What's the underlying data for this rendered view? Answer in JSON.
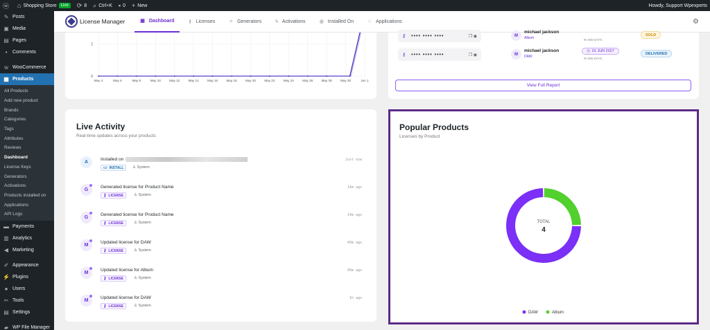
{
  "adminbar": {
    "site_name": "Shopping Store",
    "live_badge": "Live",
    "updates_count": "8",
    "shortcut": "Ctrl+K",
    "comments_count": "0",
    "new_label": "New",
    "howdy": "Howdy, Support Wpexperts"
  },
  "sidebar": {
    "items_top": [
      "Posts",
      "Media",
      "Pages",
      "Comments"
    ],
    "woocommerce": "WooCommerce",
    "products": "Products",
    "submenu": [
      "All Products",
      "Add new product",
      "Brands",
      "Categories",
      "Tags",
      "Attributes",
      "Reviews",
      "Dashboard",
      "License Keys",
      "Generators",
      "Activations",
      "Products installed on",
      "Applications",
      "API Logs"
    ],
    "items_mid": [
      "Payments",
      "Analytics",
      "Marketing"
    ],
    "items_bottom": [
      "Appearance",
      "Plugins",
      "Users",
      "Tools",
      "Settings"
    ],
    "file_manager": "WP File Manager"
  },
  "topnav": {
    "logo": "License Manager",
    "tabs": [
      "Dashboard",
      "Licenses",
      "Generators",
      "Activations",
      "Installed On",
      "Applications"
    ]
  },
  "chart": {
    "y_ticks": [
      "2",
      "0"
    ],
    "x_ticks": [
      "May 4",
      "May 6",
      "May 8",
      "May 10",
      "May 12",
      "May 14",
      "May 16",
      "May 18",
      "May 20",
      "May 22",
      "May 24",
      "May 26",
      "May 28",
      "May 30",
      "Jun 1"
    ]
  },
  "chart_data": {
    "type": "line",
    "x": [
      "May 4",
      "May 6",
      "May 8",
      "May 10",
      "May 12",
      "May 14",
      "May 16",
      "May 18",
      "May 20",
      "May 22",
      "May 24",
      "May 26",
      "May 28",
      "May 30",
      "Jun 1"
    ],
    "series": [
      {
        "values": [
          0,
          0,
          0,
          0,
          0,
          0,
          0,
          0,
          0,
          0,
          0,
          0,
          0,
          0,
          4
        ]
      }
    ],
    "ylim": [
      0,
      4
    ],
    "grid": true
  },
  "orders": {
    "rows": [
      {
        "mask": "•••• •••• ••••",
        "avatar": "M",
        "name": "michael jackson",
        "product": "Album",
        "expiry": "",
        "expiry_note": "IN 365 DAYS",
        "status": "SOLD",
        "status_color": "#c58a00"
      },
      {
        "mask": "•••• •••• ••••",
        "avatar": "M",
        "name": "michael jackson",
        "product": "DAW",
        "expiry": "01 JUN 2027",
        "expiry_note": "IN 365 DAYS",
        "status": "DELIVERED",
        "status_color": "#2271b1"
      }
    ],
    "view_full": "View Full Report"
  },
  "activity": {
    "title": "Live Activity",
    "subtitle": "Real-time updates across your products",
    "items": [
      {
        "avatar": "A",
        "title": "Installed on",
        "tag": "INSTALL",
        "by": "System",
        "time": "Just now"
      },
      {
        "avatar": "G",
        "title": "Generated license for Product Name",
        "tag": "LICENSE",
        "by": "System",
        "time": "14m ago"
      },
      {
        "avatar": "G",
        "title": "Generated license for Product Name",
        "tag": "LICENSE",
        "by": "System",
        "time": "14m ago"
      },
      {
        "avatar": "M",
        "title": "Updated license for DAW",
        "tag": "LICENSE",
        "by": "System",
        "time": "40m ago"
      },
      {
        "avatar": "M",
        "title": "Updated license for Album",
        "tag": "LICENSE",
        "by": "System",
        "time": "40m ago"
      },
      {
        "avatar": "M",
        "title": "Updated license for DAW",
        "tag": "LICENSE",
        "by": "System",
        "time": "1h ago"
      }
    ]
  },
  "popular": {
    "title": "Popular Products",
    "subtitle": "Licenses by Product",
    "total_label": "TOTAL",
    "total_value": "4",
    "legend": [
      {
        "name": "DAW",
        "color": "#7b2ff7"
      },
      {
        "name": "Album",
        "color": "#52d02e"
      }
    ],
    "chart_data": {
      "type": "pie",
      "categories": [
        "DAW",
        "Album"
      ],
      "values": [
        3,
        1
      ]
    }
  }
}
